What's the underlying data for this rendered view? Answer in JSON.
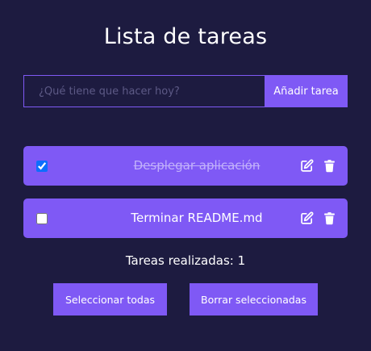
{
  "header": {
    "title": "Lista de tareas"
  },
  "new_task": {
    "placeholder": "¿Qué tiene que hacer hoy?",
    "value": "",
    "add_label": "Añadir tarea"
  },
  "tasks": [
    {
      "text": "Desplegar aplicación",
      "completed": true,
      "icons": [
        "edit-icon",
        "trash-icon"
      ]
    },
    {
      "text": "Terminar README.md",
      "completed": false,
      "icons": [
        "edit-icon",
        "trash-icon"
      ]
    }
  ],
  "footer": {
    "completed_count_text": "Tareas realizadas: 1",
    "select_all_label": "Seleccionar todas",
    "delete_selected_label": "Borrar seleccionadas"
  },
  "colors": {
    "background": "#1d1b40",
    "accent": "#7f59f5",
    "text": "#ffffff",
    "checkbox": "#0d6efd"
  }
}
